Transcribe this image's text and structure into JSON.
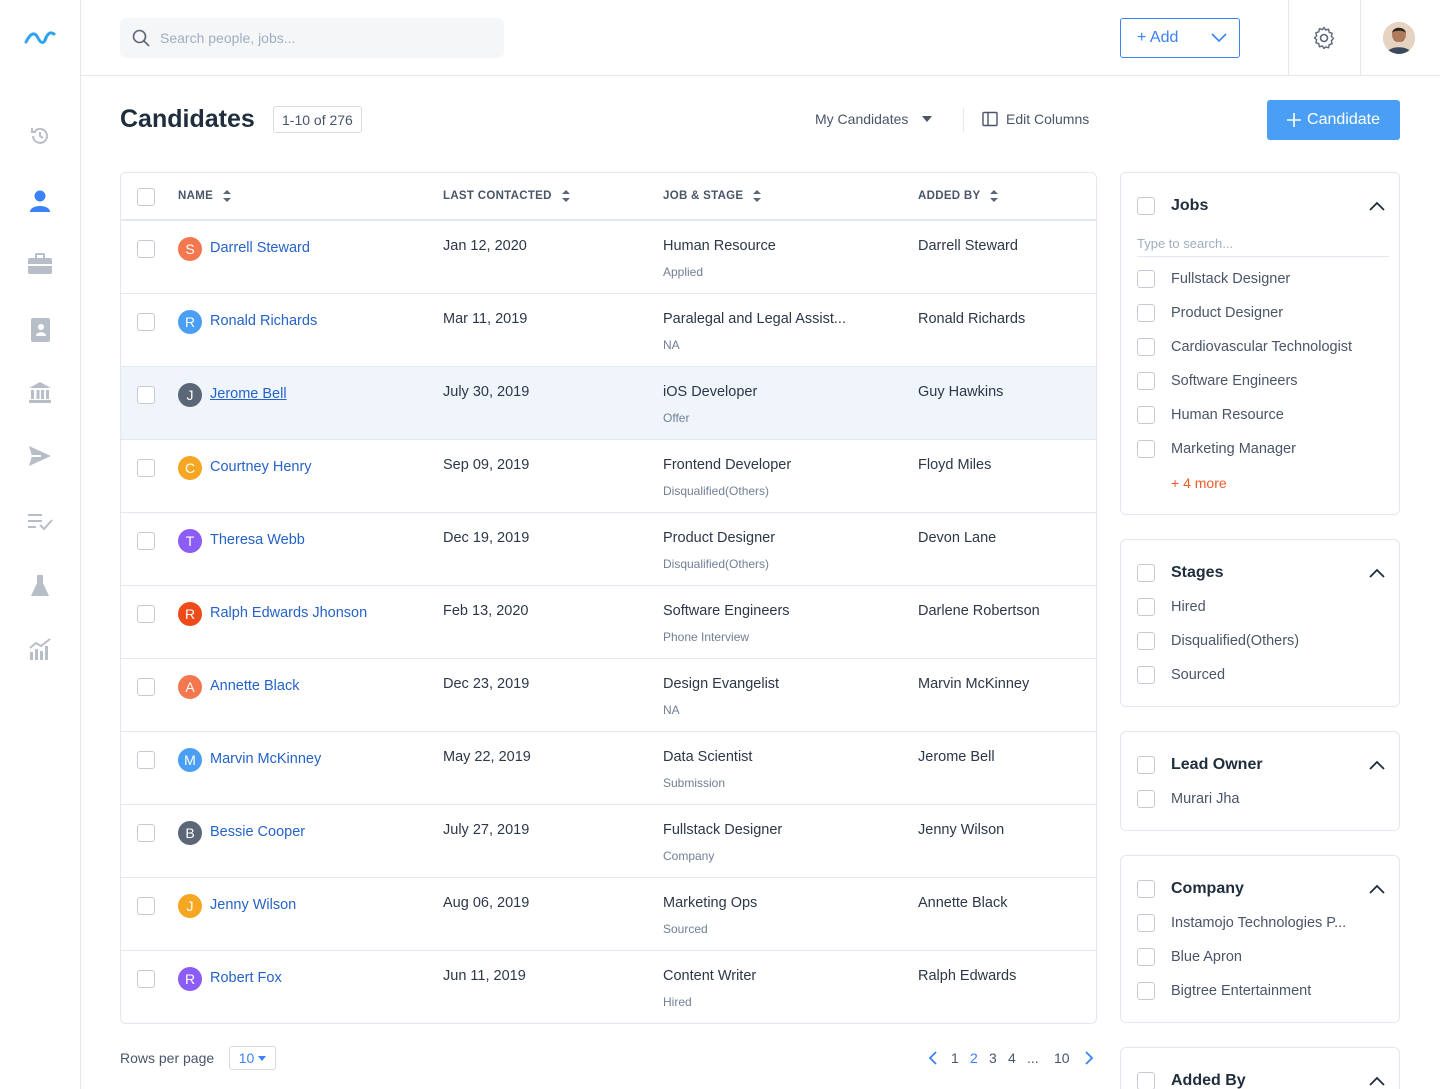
{
  "search": {
    "placeholder": "Search people, jobs..."
  },
  "topbar": {
    "add_label": "+ Add"
  },
  "header": {
    "title": "Candidates",
    "count": "1-10 of 276",
    "view_label": "My Candidates",
    "edit_columns": "Edit Columns",
    "new_button": "Candidate"
  },
  "table": {
    "columns": [
      "NAME",
      "LAST CONTACTED",
      "JOB & STAGE",
      "ADDED BY"
    ],
    "rows": [
      {
        "initial": "S",
        "color": "#f3774f",
        "name": "Darrell Steward",
        "contacted": "Jan 12, 2020",
        "job": "Human Resource",
        "stage": "Applied",
        "added_by": "Darrell Steward"
      },
      {
        "initial": "R",
        "color": "#4a9ff5",
        "name": "Ronald Richards",
        "contacted": "Mar 11, 2019",
        "job": "Paralegal and Legal Assist...",
        "stage": "NA",
        "added_by": "Ronald Richards"
      },
      {
        "initial": "J",
        "color": "#5b6777",
        "name": "Jerome Bell",
        "contacted": "July 30, 2019",
        "job": "iOS Developer",
        "stage": "Offer",
        "added_by": "Guy Hawkins"
      },
      {
        "initial": "C",
        "color": "#f5a623",
        "name": "Courtney Henry",
        "contacted": "Sep 09, 2019",
        "job": "Frontend Developer",
        "stage": "Disqualified(Others)",
        "added_by": "Floyd Miles"
      },
      {
        "initial": "T",
        "color": "#8b5cf6",
        "name": "Theresa Webb",
        "contacted": "Dec 19, 2019",
        "job": "Product Designer",
        "stage": "Disqualified(Others)",
        "added_by": "Devon Lane"
      },
      {
        "initial": "R",
        "color": "#ee4a1a",
        "name": "Ralph Edwards Jhonson",
        "contacted": "Feb 13, 2020",
        "job": "Software Engineers",
        "stage": "Phone Interview",
        "added_by": "Darlene Robertson"
      },
      {
        "initial": "A",
        "color": "#f3774f",
        "name": "Annette Black",
        "contacted": "Dec 23, 2019",
        "job": "Design Evangelist",
        "stage": "NA",
        "added_by": "Marvin McKinney"
      },
      {
        "initial": "M",
        "color": "#4a9ff5",
        "name": "Marvin McKinney",
        "contacted": "May 22, 2019",
        "job": "Data Scientist",
        "stage": "Submission",
        "added_by": "Jerome Bell"
      },
      {
        "initial": "B",
        "color": "#5b6777",
        "name": "Bessie Cooper",
        "contacted": "July 27, 2019",
        "job": "Fullstack Designer",
        "stage": "Company",
        "added_by": "Jenny Wilson"
      },
      {
        "initial": "J",
        "color": "#f5a623",
        "name": "Jenny Wilson",
        "contacted": "Aug 06, 2019",
        "job": "Marketing Ops",
        "stage": "Sourced",
        "added_by": "Annette Black"
      },
      {
        "initial": "R",
        "color": "#8b5cf6",
        "name": "Robert Fox",
        "contacted": "Jun 11, 2019",
        "job": "Content Writer",
        "stage": "Hired",
        "added_by": "Ralph Edwards"
      }
    ]
  },
  "pagination": {
    "rows_per_page_label": "Rows per page",
    "rows_per_page": "10",
    "pages": [
      "1",
      "2",
      "3",
      "4",
      "...",
      "10"
    ],
    "current": "2"
  },
  "filters": {
    "jobs": {
      "title": "Jobs",
      "placeholder": "Type to search...",
      "options": [
        "Fullstack Designer",
        "Product Designer",
        "Cardiovascular Technologist",
        "Software Engineers",
        "Human Resource",
        "Marketing Manager"
      ],
      "more": "+ 4 more"
    },
    "stages": {
      "title": "Stages",
      "options": [
        "Hired",
        "Disqualified(Others)",
        "Sourced"
      ]
    },
    "lead_owner": {
      "title": "Lead Owner",
      "options": [
        "Murari Jha"
      ]
    },
    "company": {
      "title": "Company",
      "options": [
        "Instamojo Technologies P...",
        "Blue Apron",
        "Bigtree Entertainment"
      ]
    },
    "added_by": {
      "title": "Added By"
    }
  },
  "colors": {
    "accent": "#3b82f6",
    "primary_button": "#4a9ff5",
    "more_link": "#f05a28",
    "highlight_row": "#f0f5fb"
  }
}
